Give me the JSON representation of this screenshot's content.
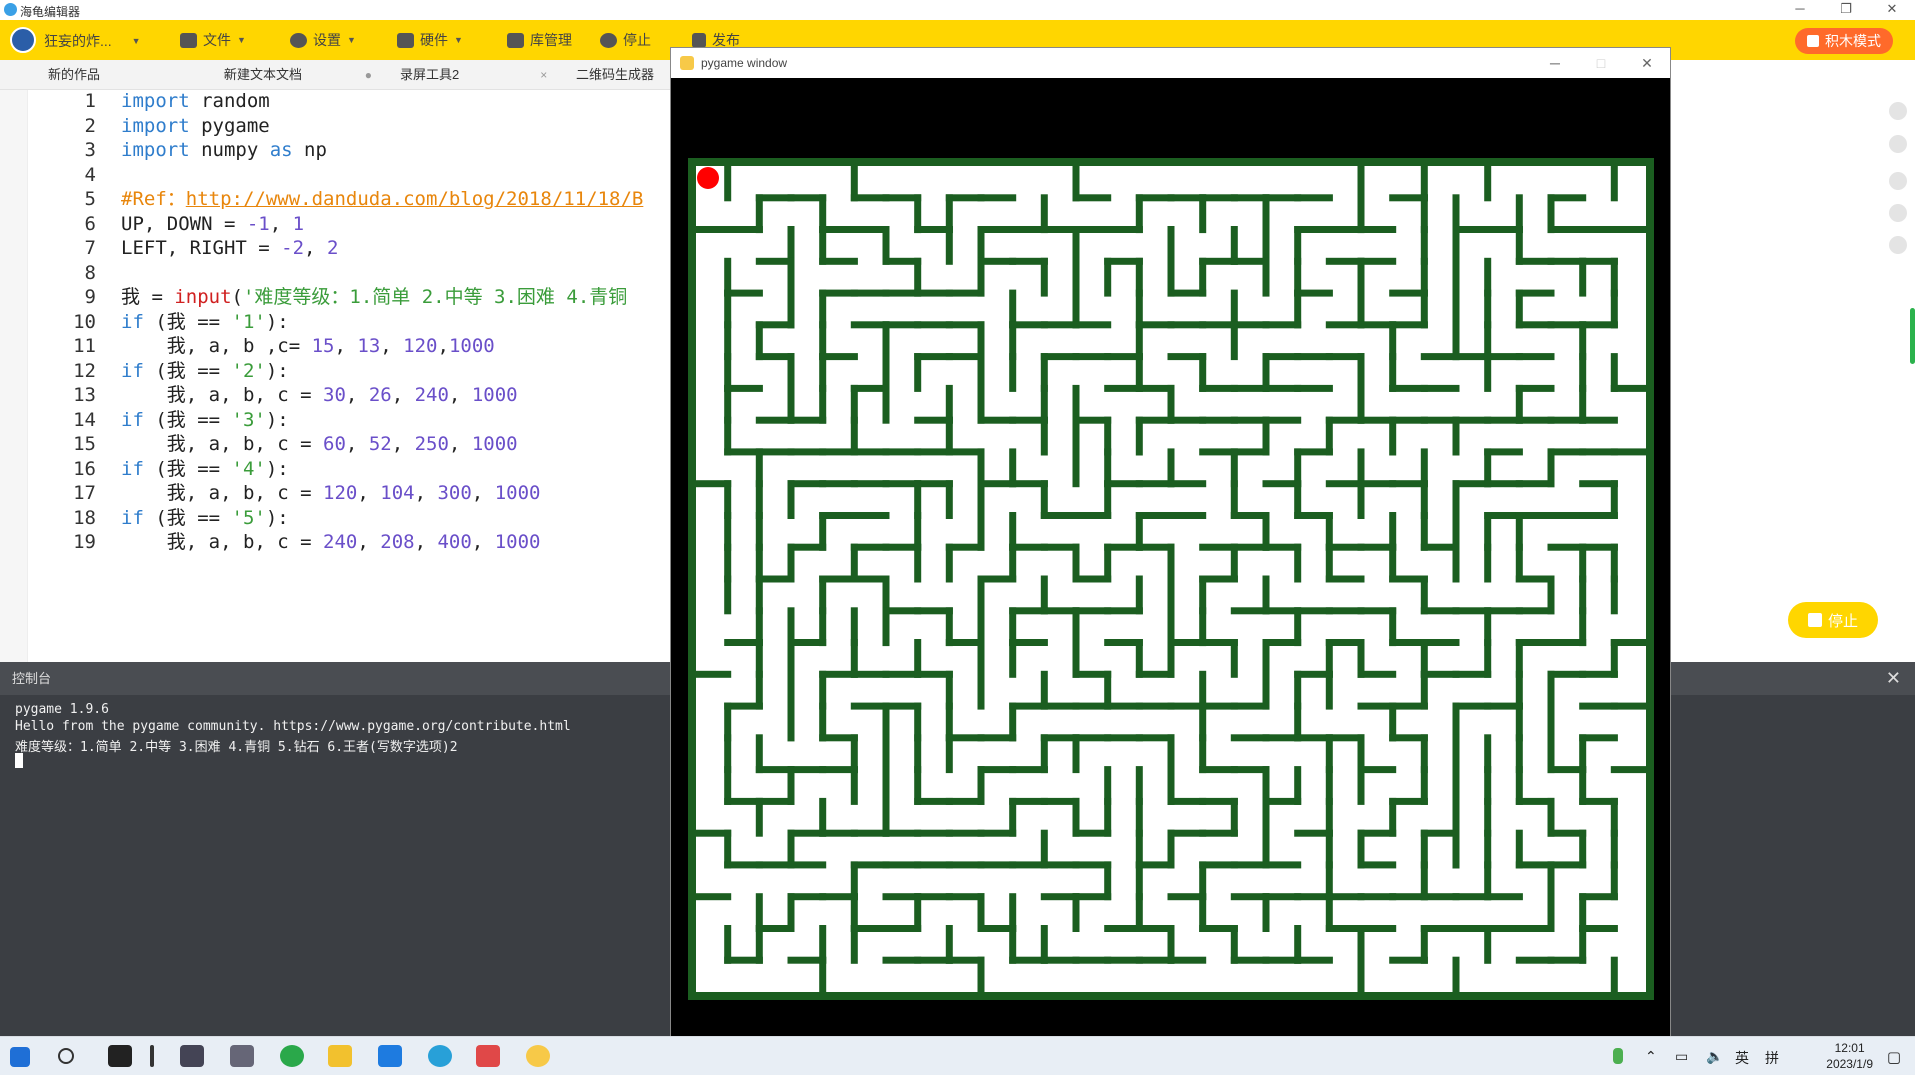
{
  "window": {
    "title": "海龟编辑器"
  },
  "menubar": {
    "user": "狂妄的炸...",
    "items": [
      {
        "label": "文件",
        "icon": "folder-icon"
      },
      {
        "label": "设置",
        "icon": "gear-icon"
      },
      {
        "label": "硬件",
        "icon": "hardware-icon"
      },
      {
        "label": "库管理",
        "icon": "library-icon"
      },
      {
        "label": "停止",
        "icon": "stop-icon"
      },
      {
        "label": "发布",
        "icon": "publish-icon"
      }
    ],
    "block_mode": "积木模式"
  },
  "tabs": [
    {
      "label": "新的作品",
      "close": "×"
    },
    {
      "label": "新建文本文档",
      "close": "●"
    },
    {
      "label": "录屏工具2",
      "close": "×"
    },
    {
      "label": "二维码生成器",
      "close": ""
    }
  ],
  "editor": {
    "line_numbers": [
      "1",
      "2",
      "3",
      "4",
      "5",
      "6",
      "7",
      "8",
      "9",
      "10",
      "11",
      "12",
      "13",
      "14",
      "15",
      "16",
      "17",
      "18",
      "19"
    ],
    "lines": [
      {
        "segs": [
          {
            "t": "import",
            "c": "kw"
          },
          {
            "t": " random",
            "c": ""
          }
        ]
      },
      {
        "segs": [
          {
            "t": "import",
            "c": "kw"
          },
          {
            "t": " pygame",
            "c": ""
          }
        ]
      },
      {
        "segs": [
          {
            "t": "import",
            "c": "kw"
          },
          {
            "t": " numpy ",
            "c": ""
          },
          {
            "t": "as",
            "c": "kw"
          },
          {
            "t": " np",
            "c": ""
          }
        ]
      },
      {
        "segs": []
      },
      {
        "segs": [
          {
            "t": "#Ref：",
            "c": "cmt"
          },
          {
            "t": "http://www.danduda.com/blog/2018/11/18/B",
            "c": "url"
          }
        ]
      },
      {
        "segs": [
          {
            "t": "UP, DOWN = ",
            "c": ""
          },
          {
            "t": "-1",
            "c": "num"
          },
          {
            "t": ", ",
            "c": ""
          },
          {
            "t": "1",
            "c": "num"
          }
        ]
      },
      {
        "segs": [
          {
            "t": "LEFT, RIGHT = ",
            "c": ""
          },
          {
            "t": "-2",
            "c": "num"
          },
          {
            "t": ", ",
            "c": ""
          },
          {
            "t": "2",
            "c": "num"
          }
        ]
      },
      {
        "segs": []
      },
      {
        "segs": [
          {
            "t": "我 = ",
            "c": ""
          },
          {
            "t": "input",
            "c": "fn"
          },
          {
            "t": "(",
            "c": ""
          },
          {
            "t": "'难度等级：1.简单 2.中等 3.困难 4.青铜",
            "c": "str"
          }
        ]
      },
      {
        "segs": [
          {
            "t": "if",
            "c": "kw"
          },
          {
            "t": " (我 == ",
            "c": ""
          },
          {
            "t": "'1'",
            "c": "str"
          },
          {
            "t": "):",
            "c": ""
          }
        ]
      },
      {
        "segs": [
          {
            "t": "    我, a, b ,c= ",
            "c": ""
          },
          {
            "t": "15",
            "c": "num"
          },
          {
            "t": ", ",
            "c": ""
          },
          {
            "t": "13",
            "c": "num"
          },
          {
            "t": ", ",
            "c": ""
          },
          {
            "t": "120",
            "c": "num"
          },
          {
            "t": ",",
            "c": ""
          },
          {
            "t": "1000",
            "c": "num"
          }
        ]
      },
      {
        "segs": [
          {
            "t": "if",
            "c": "kw"
          },
          {
            "t": " (我 == ",
            "c": ""
          },
          {
            "t": "'2'",
            "c": "str"
          },
          {
            "t": "):",
            "c": ""
          }
        ]
      },
      {
        "segs": [
          {
            "t": "    我, a, b, c = ",
            "c": ""
          },
          {
            "t": "30",
            "c": "num"
          },
          {
            "t": ", ",
            "c": ""
          },
          {
            "t": "26",
            "c": "num"
          },
          {
            "t": ", ",
            "c": ""
          },
          {
            "t": "240",
            "c": "num"
          },
          {
            "t": ", ",
            "c": ""
          },
          {
            "t": "1000",
            "c": "num"
          }
        ]
      },
      {
        "segs": [
          {
            "t": "if",
            "c": "kw"
          },
          {
            "t": " (我 == ",
            "c": ""
          },
          {
            "t": "'3'",
            "c": "str"
          },
          {
            "t": "):",
            "c": ""
          }
        ]
      },
      {
        "segs": [
          {
            "t": "    我, a, b, c = ",
            "c": ""
          },
          {
            "t": "60",
            "c": "num"
          },
          {
            "t": ", ",
            "c": ""
          },
          {
            "t": "52",
            "c": "num"
          },
          {
            "t": ", ",
            "c": ""
          },
          {
            "t": "250",
            "c": "num"
          },
          {
            "t": ", ",
            "c": ""
          },
          {
            "t": "1000",
            "c": "num"
          }
        ]
      },
      {
        "segs": [
          {
            "t": "if",
            "c": "kw"
          },
          {
            "t": " (我 == ",
            "c": ""
          },
          {
            "t": "'4'",
            "c": "str"
          },
          {
            "t": "):",
            "c": ""
          }
        ]
      },
      {
        "segs": [
          {
            "t": "    我, a, b, c = ",
            "c": ""
          },
          {
            "t": "120",
            "c": "num"
          },
          {
            "t": ", ",
            "c": ""
          },
          {
            "t": "104",
            "c": "num"
          },
          {
            "t": ", ",
            "c": ""
          },
          {
            "t": "300",
            "c": "num"
          },
          {
            "t": ", ",
            "c": ""
          },
          {
            "t": "1000",
            "c": "num"
          }
        ]
      },
      {
        "segs": [
          {
            "t": "if",
            "c": "kw"
          },
          {
            "t": " (我 == ",
            "c": ""
          },
          {
            "t": "'5'",
            "c": "str"
          },
          {
            "t": "):",
            "c": ""
          }
        ]
      },
      {
        "segs": [
          {
            "t": "    我, a, b, c = ",
            "c": ""
          },
          {
            "t": "240",
            "c": "num"
          },
          {
            "t": ", ",
            "c": ""
          },
          {
            "t": "208",
            "c": "num"
          },
          {
            "t": ", ",
            "c": ""
          },
          {
            "t": "400",
            "c": "num"
          },
          {
            "t": ", ",
            "c": ""
          },
          {
            "t": "1000",
            "c": "num"
          }
        ]
      }
    ]
  },
  "stop_button": "停止",
  "console": {
    "title": "控制台",
    "close": "✕",
    "lines": [
      "pygame 1.9.6",
      "Hello from the pygame community. https://www.pygame.org/contribute.html",
      "难度等级：1.简单 2.中等 3.困难 4.青铜 5.钻石 6.王者(写数字选项)2"
    ]
  },
  "pygame_window": {
    "title": "pygame window",
    "wall_color": "#1b5e20",
    "path_color": "#ffffff",
    "player_color": "#ff0000"
  },
  "taskbar": {
    "ime_lang": "英",
    "ime_mode": "拼",
    "time": "12:01",
    "date": "2023/1/9"
  }
}
